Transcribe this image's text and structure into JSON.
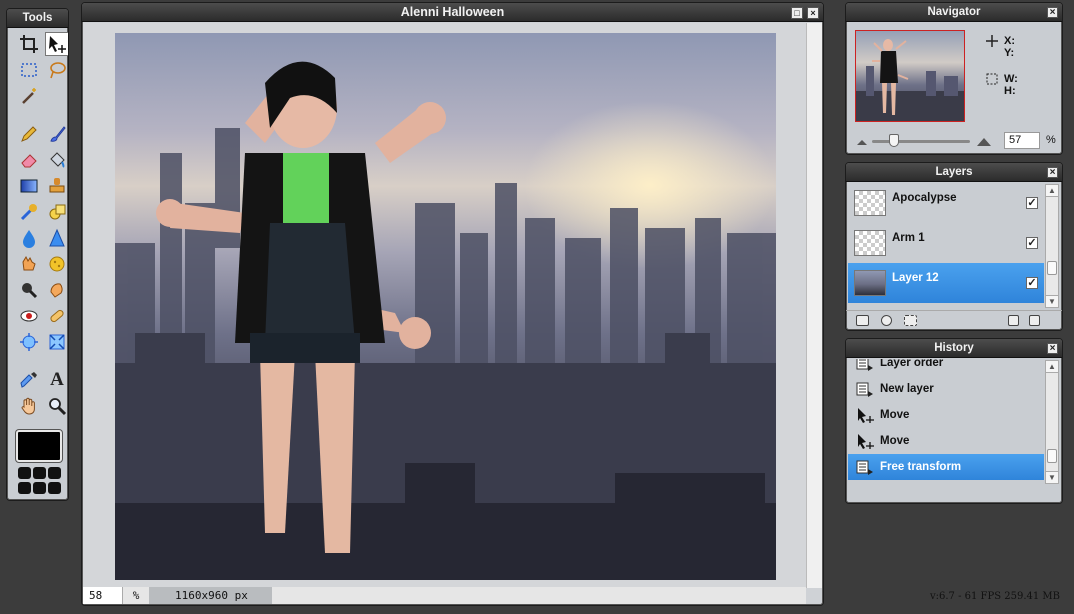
{
  "tools": {
    "title": "Tools",
    "items": [
      "crop-icon",
      "move-icon",
      "marquee-icon",
      "lasso-icon",
      "magic-wand-icon",
      "pencil-icon",
      "brush-icon",
      "eraser-icon",
      "paint-bucket-icon",
      "gradient-icon",
      "clone-stamp-icon",
      "color-replace-icon",
      "shape-icon",
      "blur-icon",
      "sharpen-icon",
      "smudge-icon",
      "sponge-icon",
      "burn-icon",
      "dodge-icon",
      "red-eye-icon",
      "spot-heal-icon",
      "bloat-icon",
      "pinch-icon",
      "eyedropper-icon",
      "type-icon",
      "hand-icon",
      "zoom-icon"
    ],
    "primary_color": "#000000"
  },
  "document": {
    "title": "Alenni Halloween",
    "zoom_value": "58",
    "zoom_unit": "%",
    "image_size": "1160x960 px"
  },
  "navigator": {
    "title": "Navigator",
    "x_label": "X:",
    "y_label": "Y:",
    "w_label": "W:",
    "h_label": "H:",
    "zoom_value": "57",
    "zoom_unit": "%"
  },
  "layers": {
    "title": "Layers",
    "items": [
      {
        "name": "Apocalypse",
        "visible": true,
        "selected": false
      },
      {
        "name": "Arm 1",
        "visible": true,
        "selected": false
      },
      {
        "name": "Layer 12",
        "visible": true,
        "selected": true
      }
    ]
  },
  "history": {
    "title": "History",
    "items": [
      {
        "label": "Layer order",
        "icon": "layer-icon"
      },
      {
        "label": "New layer",
        "icon": "layer-icon"
      },
      {
        "label": "Move",
        "icon": "move-icon"
      },
      {
        "label": "Move",
        "icon": "move-icon"
      },
      {
        "label": "Free transform",
        "icon": "layer-icon",
        "selected": true
      }
    ]
  },
  "footer": {
    "version": "v:6.7 - 61 FPS 259.41 MB"
  },
  "colors": {
    "selection_blue": "#3b92e4",
    "panel_bg": "#c9cdd2",
    "title_bar": "#2b2b2b"
  }
}
